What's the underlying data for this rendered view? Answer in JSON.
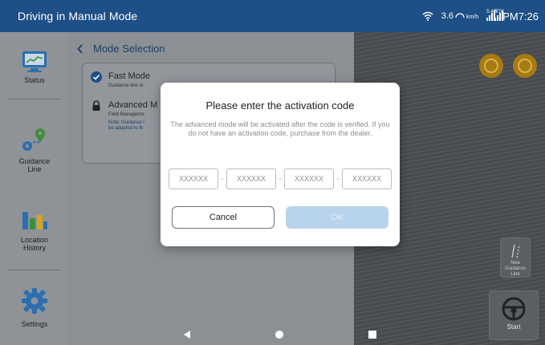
{
  "app": {
    "title": "Driving in Manual Mode"
  },
  "status_bar": {
    "speed_value": "3.6",
    "speed_unit": "km/h",
    "signal_small_label": "5.4G",
    "rtk_label": "RTK",
    "clock": "PM7:26"
  },
  "sidebar": {
    "items": [
      {
        "label": "Status",
        "icon": "monitor-chart-icon"
      },
      {
        "label": "Guidance Line",
        "icon": "route-pins-icon"
      },
      {
        "label": "Location History",
        "icon": "bar-chart-icon"
      },
      {
        "label": "Settings",
        "icon": "gear-icon"
      }
    ]
  },
  "content": {
    "breadcrumb": "Mode Selection",
    "modes": [
      {
        "title": "Fast Mode",
        "sub": "Guidance line or",
        "icon": "check-circle-icon"
      },
      {
        "title": "Advanced M",
        "sub": "Field Manageme",
        "note_1": "Note: Guidance l",
        "note_2": "be adapted to th",
        "icon": "lock-icon"
      }
    ]
  },
  "map": {
    "tile_guidance": "New Guidance Line",
    "tile_start": "Start"
  },
  "dialog": {
    "title": "Please enter the activation code",
    "message": "The advanced mode will be activated after the code is verified. If you do not have an activation code, purchase from the dealer.",
    "code_placeholder": "XXXXXX",
    "codes": [
      "XXXXXX",
      "XXXXXX",
      "XXXXXX",
      "XXXXXX"
    ],
    "cancel_label": "Cancel",
    "ok_label": "OK"
  },
  "colors": {
    "topbar": "#1e4f86",
    "accent": "#2f6fb4",
    "ok_disabled": "#b8d3ee"
  }
}
